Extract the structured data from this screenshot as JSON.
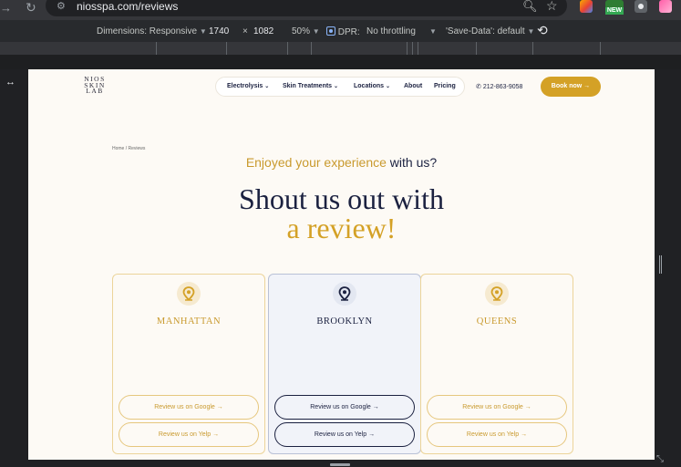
{
  "browser": {
    "url": "niosspa.com/reviews",
    "extension_badge": "NEW"
  },
  "device_toolbar": {
    "dimensions_label": "Dimensions: Responsive",
    "width": "1740",
    "times": "×",
    "height": "1082",
    "zoom": "50%",
    "dpr_label": "DPR:",
    "throttling": "No throttling",
    "save_data": "'Save-Data': default"
  },
  "site": {
    "logo_lines": [
      "NIOS",
      "SKIN",
      "LAB"
    ],
    "nav": {
      "electrolysis": "Electrolysis",
      "skin_treatments": "Skin Treatments",
      "locations": "Locations",
      "about": "About",
      "pricing": "Pricing"
    },
    "phone": "212-863-9058",
    "book_button": "Book now →",
    "breadcrumb": "Home / Reviews",
    "kicker_gold": "Enjoyed your experience",
    "kicker_dark": " with us?",
    "headline_line1": "Shout us out with",
    "headline_line2": "a review!",
    "locations": [
      {
        "city": "MANHATTAN",
        "google": "Review us on Google →",
        "yelp": "Review us on Yelp →"
      },
      {
        "city": "BROOKLYN",
        "google": "Review us on Google →",
        "yelp": "Review us on Yelp →"
      },
      {
        "city": "QUEENS",
        "google": "Review us on Google →",
        "yelp": "Review us on Yelp →"
      }
    ]
  },
  "colors": {
    "gold": "#d4a126",
    "navy": "#1b2140",
    "page_bg": "#fdfaf5",
    "active_card_bg": "#f1f3f9"
  }
}
